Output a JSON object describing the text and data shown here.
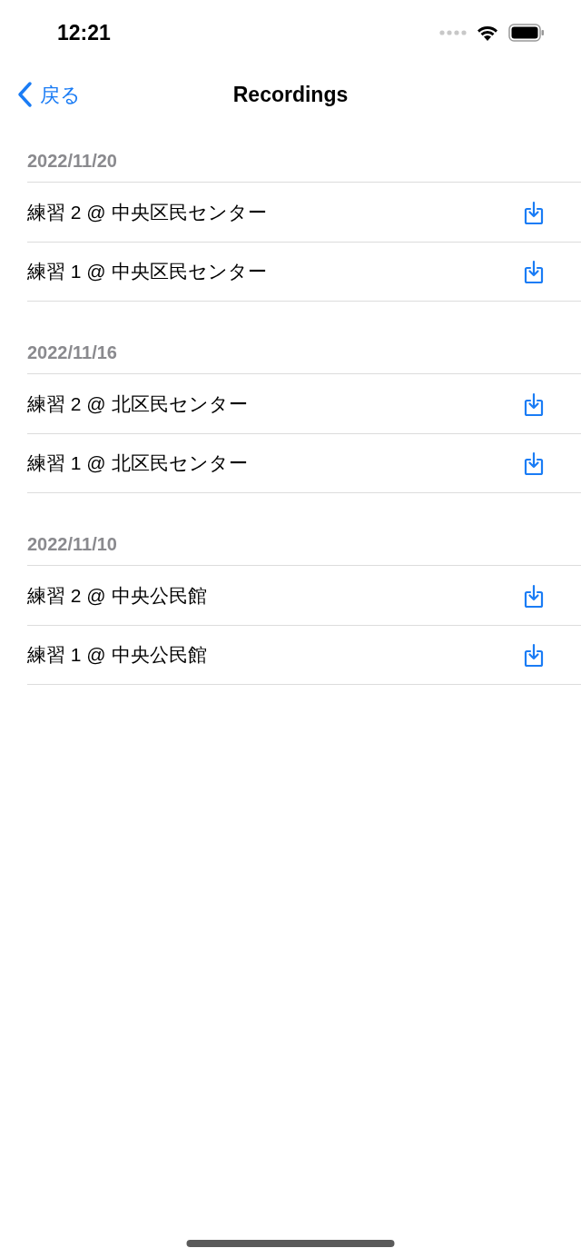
{
  "status_bar": {
    "time": "12:21"
  },
  "nav": {
    "back": "戻る",
    "title": "Recordings"
  },
  "sections": [
    {
      "date": "2022/11/20",
      "rows": [
        {
          "title": "練習 2 @ 中央区民センター"
        },
        {
          "title": "練習 1 @ 中央区民センター"
        }
      ]
    },
    {
      "date": "2022/11/16",
      "rows": [
        {
          "title": "練習 2 @ 北区民センター"
        },
        {
          "title": "練習 1 @ 北区民センター"
        }
      ]
    },
    {
      "date": "2022/11/10",
      "rows": [
        {
          "title": "練習 2 @ 中央公民館"
        },
        {
          "title": "練習 1 @ 中央公民館"
        }
      ]
    }
  ]
}
